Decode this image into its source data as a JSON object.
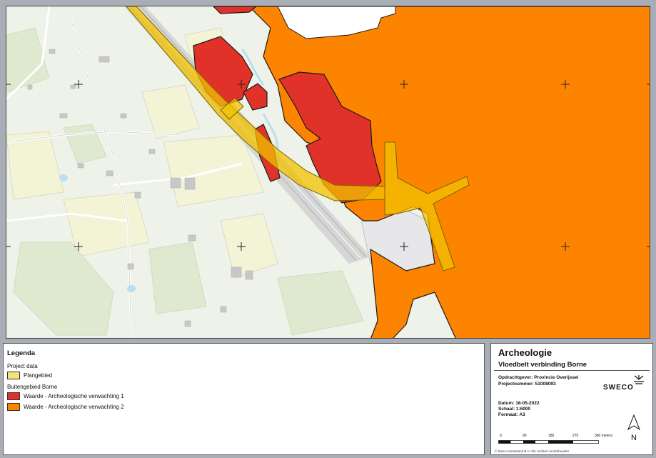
{
  "legend": {
    "title": "Legenda",
    "groups": [
      {
        "label": "Project data",
        "items": [
          {
            "label": "Plangebied",
            "color": "#f5e27a"
          }
        ]
      },
      {
        "label": "Buitengebied Borne",
        "items": [
          {
            "label": "Waarde - Archeologische verwachting 1",
            "color": "#e03228"
          },
          {
            "label": "Waarde - Archeologische verwachting 2",
            "color": "#fd8400"
          }
        ]
      }
    ]
  },
  "titleblock": {
    "title": "Archeologie",
    "subtitle": "Vloedbelt verbinding Borne",
    "client": "Opdrachtgever: Provincie Overijssel",
    "project": "Projectnummer: 51008093",
    "date": "Datum: 18-05-2022",
    "scale": "Schaal: 1:6000",
    "format": "Formaat: A3",
    "logo": "SWECO",
    "scalebar_ticks": [
      "0",
      "90",
      "180",
      "270",
      "360 meters"
    ],
    "north": "N",
    "copyright": "© Sweco Nederland B.V. Alle rechten voorbehouden"
  },
  "map": {
    "colors": {
      "background": "#eef2e8",
      "orange": "#fd8400",
      "red": "#e03228",
      "yellow": "#f2c200",
      "road": "#c9c9c9"
    }
  }
}
